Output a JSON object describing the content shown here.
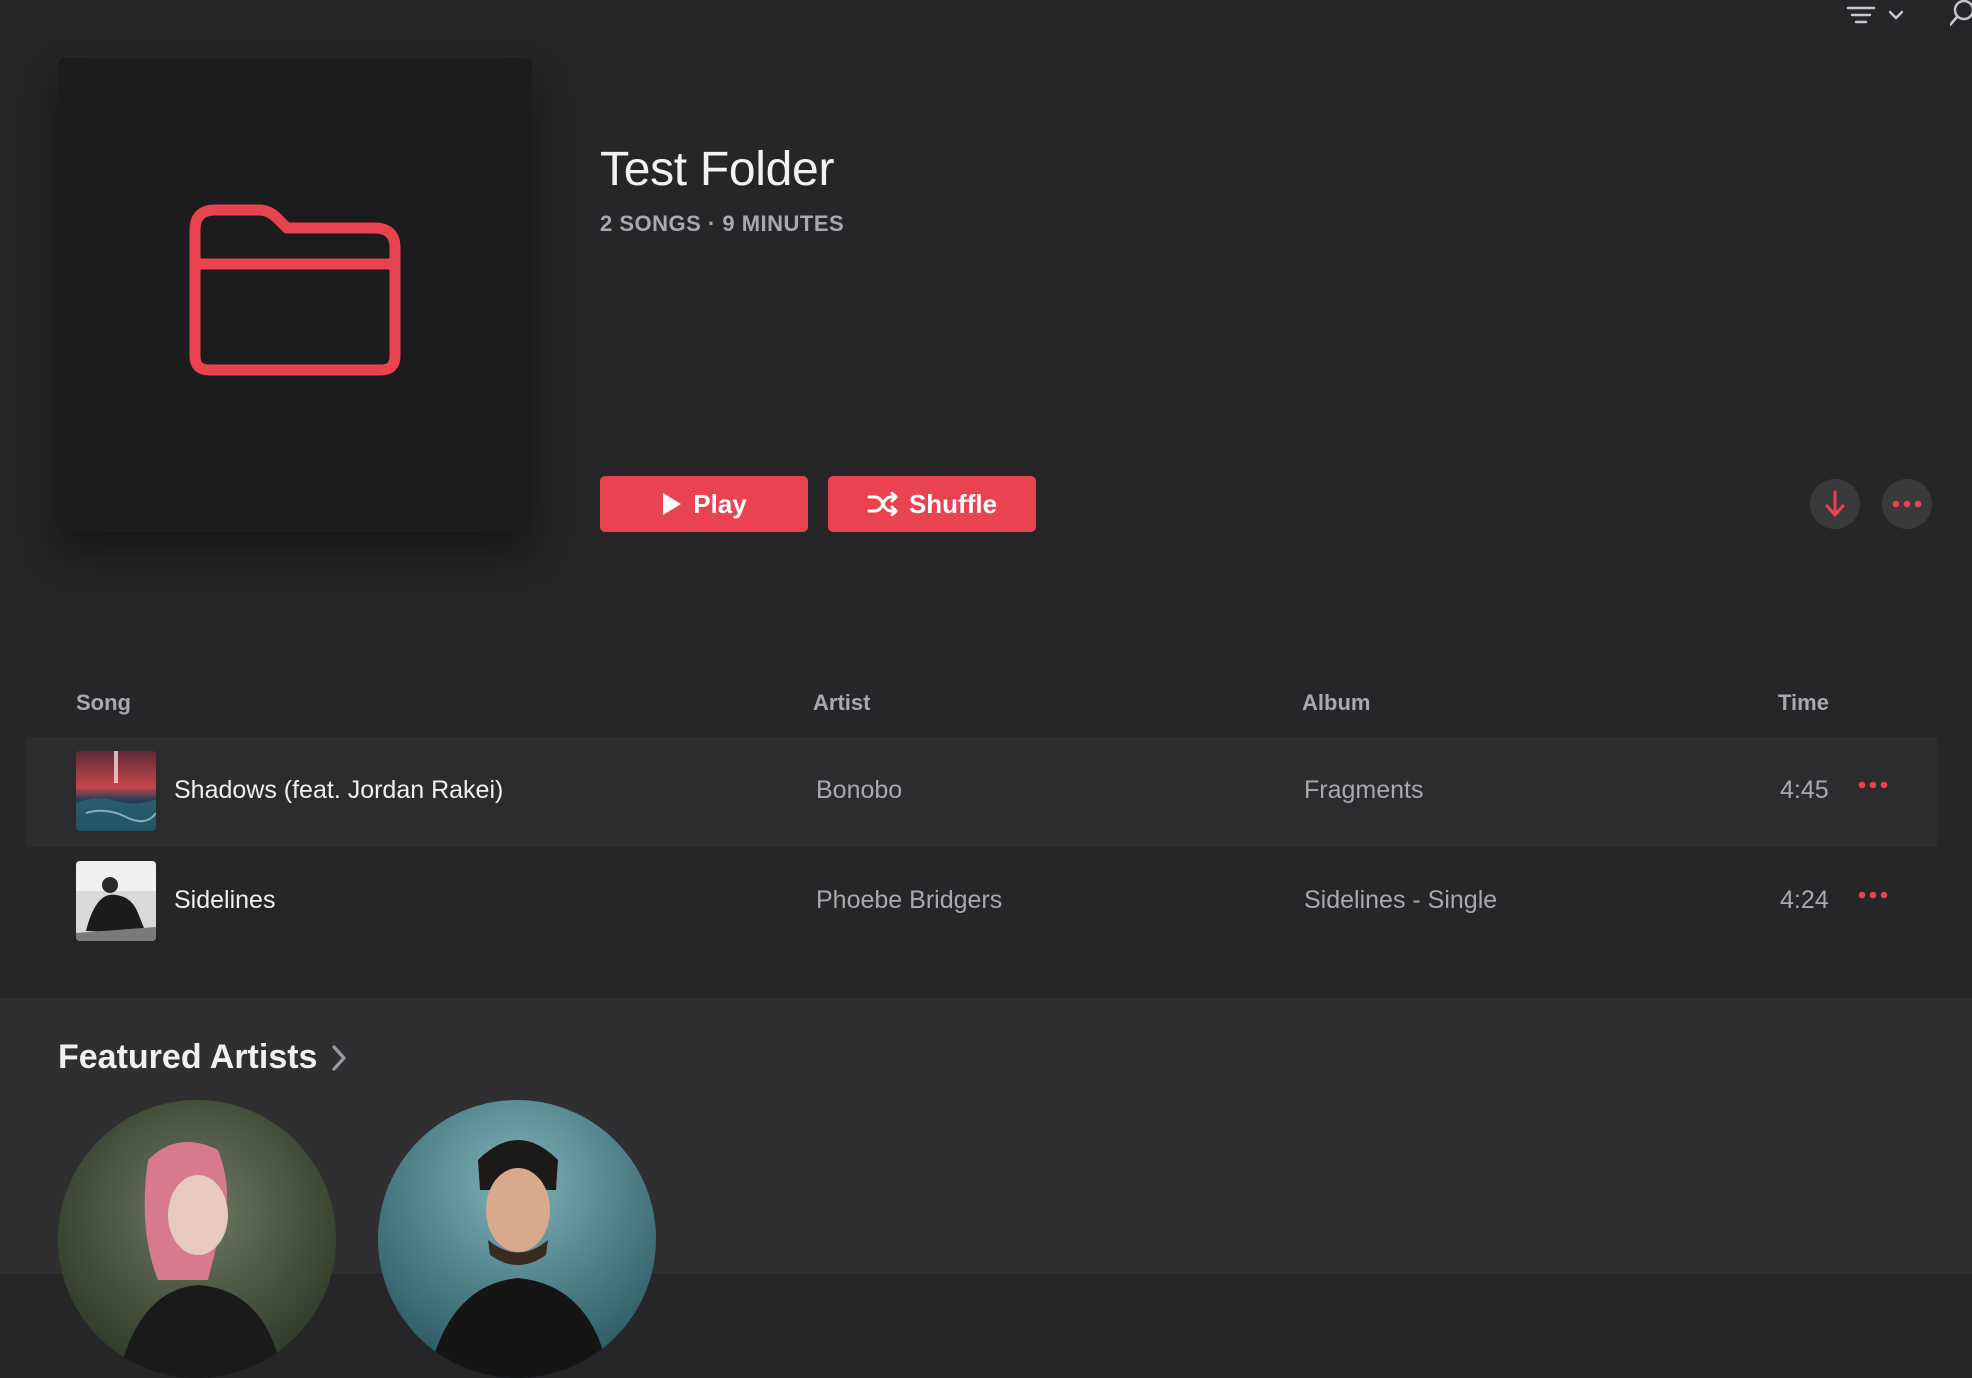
{
  "colors": {
    "accent": "#e8434f",
    "background": "#262628",
    "secondary_text": "#a9a9ad"
  },
  "toolbar": {
    "sort_icon": "sort-lines-icon",
    "chevron_icon": "chevron-down-icon",
    "search_icon": "search-icon"
  },
  "folder": {
    "icon": "folder-icon",
    "title": "Test Folder",
    "meta": "2 SONGS · 9 MINUTES"
  },
  "actions": {
    "play_label": "Play",
    "shuffle_label": "Shuffle",
    "download_icon": "arrow-down-icon",
    "more_icon": "ellipsis-icon"
  },
  "table": {
    "headers": {
      "song": "Song",
      "artist": "Artist",
      "album": "Album",
      "time": "Time"
    },
    "rows": [
      {
        "title": "Shadows (feat. Jordan Rakei)",
        "artist": "Bonobo",
        "album": "Fragments",
        "time": "4:45"
      },
      {
        "title": "Sidelines",
        "artist": "Phoebe Bridgers",
        "album": "Sidelines - Single",
        "time": "4:24"
      }
    ]
  },
  "featured": {
    "title": "Featured Artists"
  }
}
